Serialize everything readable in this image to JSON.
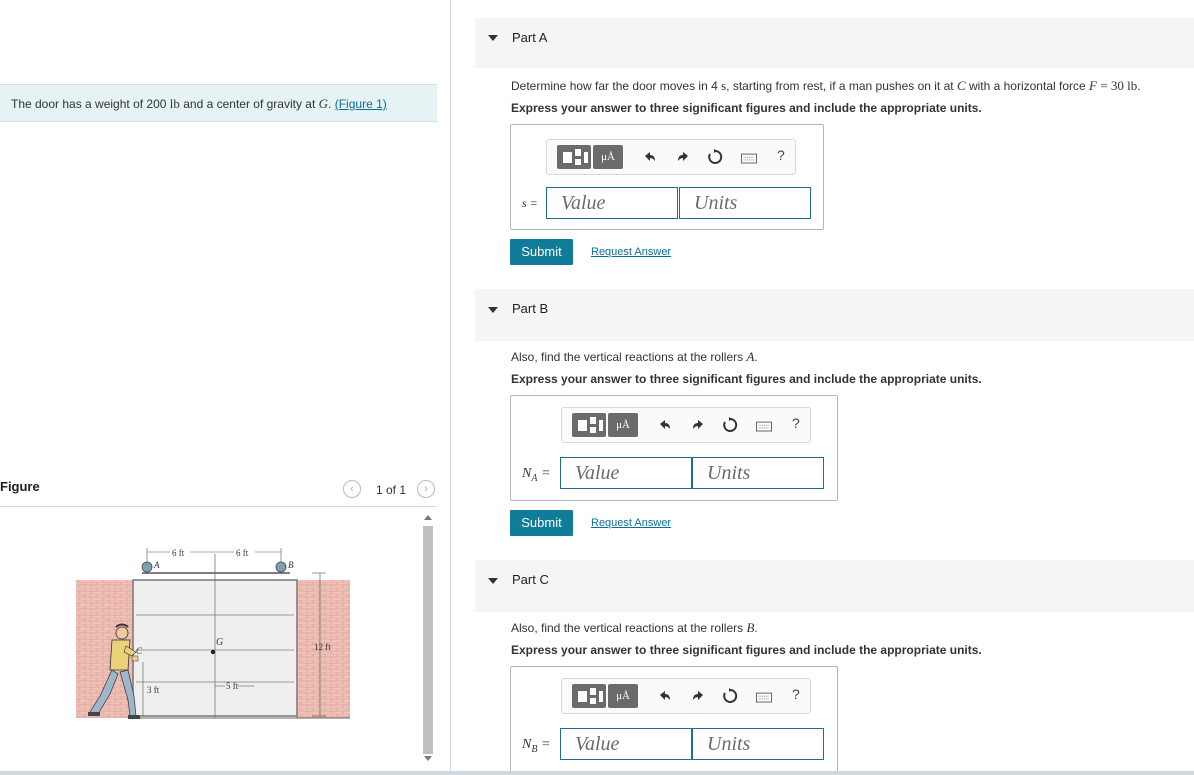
{
  "problem": {
    "intro_text": "The door has a weight of 200 lb and a center of gravity at G.",
    "figure_link": "(Figure 1)"
  },
  "figure_panel": {
    "title": "Figure",
    "pager": "1 of 1",
    "labels": {
      "dim_6ft_left": "6 ft",
      "dim_6ft_right": "6 ft",
      "dim_12ft": "12 ft",
      "dim_5ft": "5 ft",
      "dim_3ft": "3 ft",
      "point_A": "A",
      "point_B": "B",
      "point_C": "C",
      "point_G": "G"
    }
  },
  "parts": [
    {
      "label": "Part A",
      "question": "Determine how far the door moves in 4 s, starting from rest, if a man pushes on it at C with a horizontal force F = 30 lb.",
      "instruction": "Express your answer to three significant figures and include the appropriate units.",
      "variable": "s =",
      "value_placeholder": "Value",
      "units_placeholder": "Units",
      "submit_label": "Submit",
      "request_label": "Request Answer"
    },
    {
      "label": "Part B",
      "question": "Also, find the vertical reactions at the rollers A.",
      "instruction": "Express your answer to three significant figures and include the appropriate units.",
      "variable": "N",
      "variable_sub": "A",
      "value_placeholder": "Value",
      "units_placeholder": "Units",
      "submit_label": "Submit",
      "request_label": "Request Answer"
    },
    {
      "label": "Part C",
      "question": "Also, find the vertical reactions at the rollers B.",
      "instruction": "Express your answer to three significant figures and include the appropriate units.",
      "variable": "N",
      "variable_sub": "B",
      "value_placeholder": "Value",
      "units_placeholder": "Units"
    }
  ],
  "toolbar": {
    "template_icon": "template-icon",
    "symbol_label": "μÅ",
    "undo_icon": "undo-icon",
    "redo_icon": "redo-icon",
    "reset_icon": "reset-icon",
    "keyboard_icon": "keyboard-icon",
    "help_label": "?"
  },
  "colors": {
    "accent": "#0f7c9a",
    "intro_bg": "#e6f3f4",
    "link": "#0b6e99",
    "brick": "#e8a79a"
  }
}
